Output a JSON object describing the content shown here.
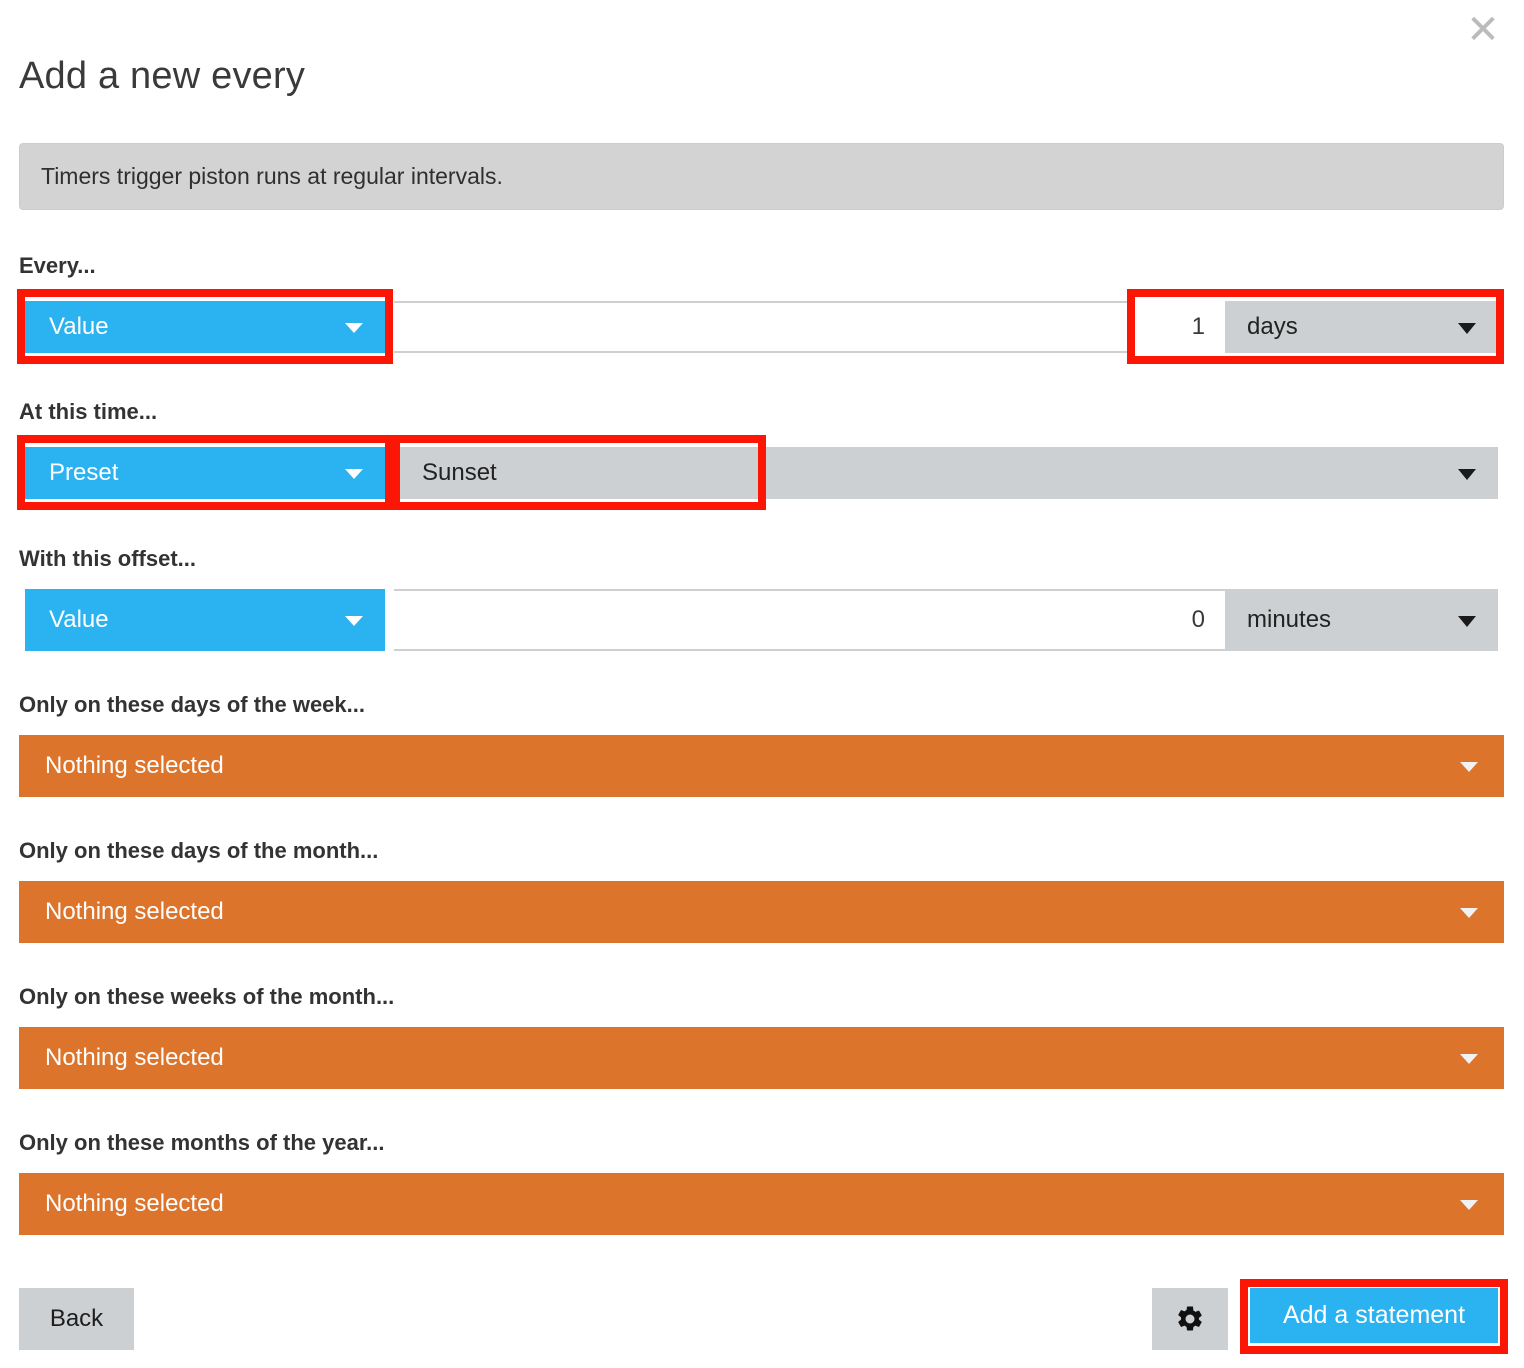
{
  "dialog": {
    "title": "Add a new every",
    "close_label": "✕",
    "info_text": "Timers trigger piston runs at regular intervals."
  },
  "colors": {
    "accent_blue": "#2bb2f0",
    "orange": "#dd742b",
    "grey": "#cdd0d2",
    "highlight_red": "#fb1605",
    "banner_grey": "#d3d3d3"
  },
  "sections": {
    "every": {
      "label": "Every...",
      "type_value": "Value",
      "interval_value": "1",
      "unit_value": "days",
      "expression_value": ""
    },
    "at_this_time": {
      "label": "At this time...",
      "type_value": "Preset",
      "preset_value": "Sunset",
      "detail_value": ""
    },
    "offset": {
      "label": "With this offset...",
      "type_value": "Value",
      "offset_value": "0",
      "unit_value": "minutes",
      "expression_value": ""
    },
    "days_of_week": {
      "label": "Only on these days of the week...",
      "selected_text": "Nothing selected"
    },
    "days_of_month": {
      "label": "Only on these days of the month...",
      "selected_text": "Nothing selected"
    },
    "weeks_of_month": {
      "label": "Only on these weeks of the month...",
      "selected_text": "Nothing selected"
    },
    "months_of_year": {
      "label": "Only on these months of the year...",
      "selected_text": "Nothing selected"
    }
  },
  "footer": {
    "back_label": "Back",
    "settings_icon": "gear-icon",
    "add_label": "Add a statement"
  }
}
